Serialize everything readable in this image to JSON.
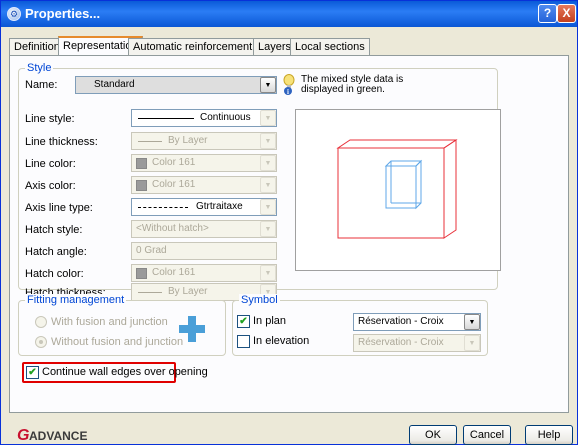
{
  "window": {
    "title": "Properties...",
    "help_label": "?",
    "close_label": "X"
  },
  "tabs": [
    {
      "label": "Definition"
    },
    {
      "label": "Representation"
    },
    {
      "label": "Automatic reinforcement"
    },
    {
      "label": "Layers"
    },
    {
      "label": "Local sections"
    }
  ],
  "style": {
    "legend": "Style",
    "name_label": "Name:",
    "name_value": "Standard",
    "hint_text_1": "The mixed style data is",
    "hint_text_2": "displayed in green.",
    "rows": [
      {
        "label": "Line style:",
        "value": "Continuous"
      },
      {
        "label": "Line thickness:",
        "value": "By Layer"
      },
      {
        "label": "Line color:",
        "value": "Color 161"
      },
      {
        "label": "Axis color:",
        "value": "Color 161"
      },
      {
        "label": "Axis line type:",
        "value": "Gtrtraitaxe"
      },
      {
        "label": "Hatch style:",
        "value": "<Without hatch>"
      },
      {
        "label": "Hatch angle:",
        "value": "0 Grad"
      },
      {
        "label": "Hatch color:",
        "value": "Color 161"
      },
      {
        "label": "Hatch thickness:",
        "value": "By Layer"
      }
    ]
  },
  "fitting": {
    "legend": "Fitting management",
    "option_1": "With fusion and junction",
    "option_2": "Without fusion and junction"
  },
  "symbol": {
    "legend": "Symbol",
    "in_plan_label": "In plan",
    "in_plan_value": "Réservation - Croix",
    "in_elevation_label": "In elevation",
    "in_elevation_value": "Réservation - Croix"
  },
  "continue_label": "Continue wall edges over opening",
  "logo_text": "ADVANCE",
  "logo_letter": "G",
  "buttons": {
    "ok": "OK",
    "cancel": "Cancel",
    "help": "Help"
  }
}
